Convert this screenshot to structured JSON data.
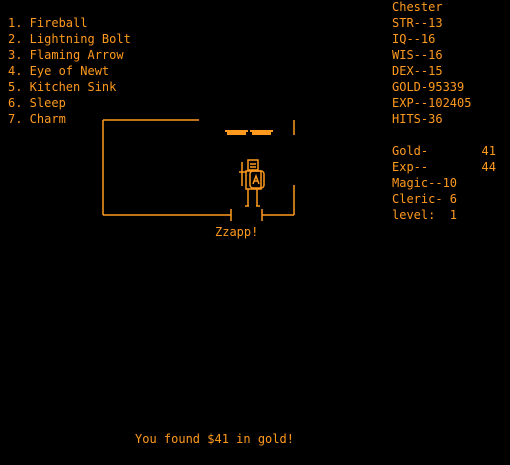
{
  "spells": [
    "1. Fireball",
    "2. Lightning Bolt",
    "3. Flaming Arrow",
    "4. Eye of Newt",
    "5. Kitchen Sink",
    "6. Sleep",
    "7. Charm"
  ],
  "character": {
    "name": "Chester",
    "str": "STR--13",
    "iq": "IQ--16",
    "wis": "WIS--16",
    "dex": "DEX--15",
    "gold": "GOLD-95339",
    "exp": "EXP--102405",
    "hits": "HITS-36"
  },
  "status": [
    {
      "label": "Gold-",
      "value": "41"
    },
    {
      "label": "Exp--",
      "value": "44"
    },
    {
      "label": "Magic--10",
      "value": ""
    },
    {
      "label": "Cleric- 6",
      "value": ""
    },
    {
      "label": "level:  1",
      "value": ""
    }
  ],
  "messages": {
    "combat": "Zzapp!",
    "found": "You found $41 in gold!"
  },
  "colors": {
    "text": "#ff9a1f",
    "background": "#000000"
  },
  "icons": {
    "player": "knight-with-shield-icon",
    "treasure": "gold-bars-icon"
  }
}
